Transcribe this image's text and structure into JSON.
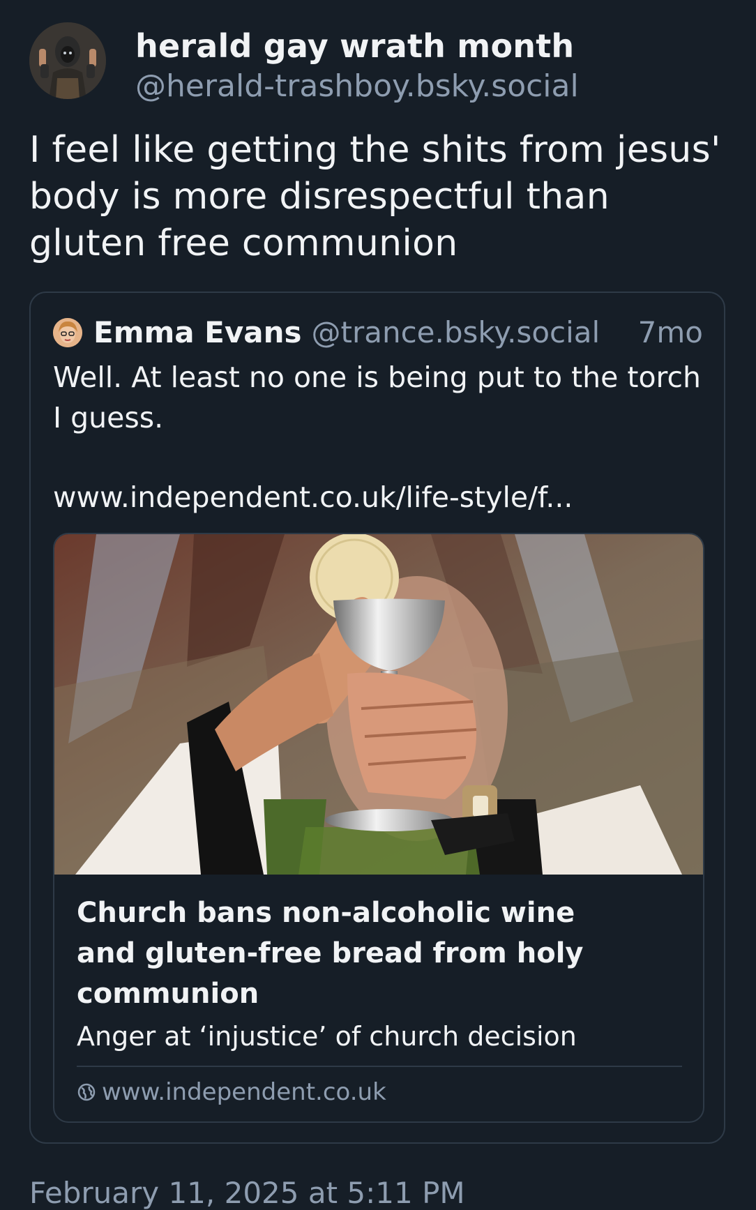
{
  "post": {
    "author": {
      "display_name": "herald gay wrath month",
      "handle": "@herald-trashboy.bsky.social"
    },
    "text": "I feel like getting the shits from jesus' body is more disrespectful than gluten free communion",
    "timestamp": "February 11, 2025 at 5:11 PM"
  },
  "quote": {
    "author_name": "Emma Evans",
    "author_handle": "@trance.bsky.social",
    "age": "7mo",
    "text": "Well. At least no one is being put to the torch I guess.",
    "link": "www.independent.co.uk/life-style/f...",
    "embed": {
      "title": "Church bans non-alcoholic wine and gluten-free bread from holy communion",
      "description": "Anger at ‘injustice’ of church decision",
      "source": "www.independent.co.uk"
    }
  },
  "colors": {
    "background": "#161e27",
    "border": "#2e3a47",
    "text": "#f1f3f5",
    "muted": "#8e9db0"
  },
  "icons": {
    "author_avatar": "avatar",
    "quote_avatar": "avatar",
    "source": "globe-icon"
  }
}
